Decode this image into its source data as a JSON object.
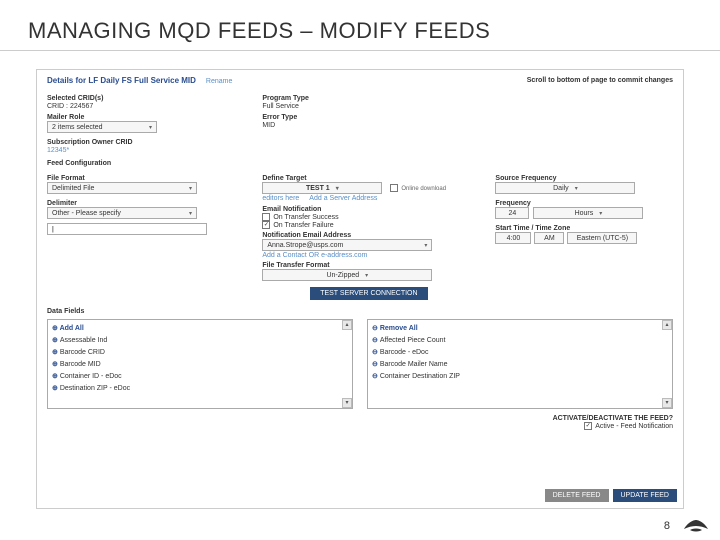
{
  "slide": {
    "title": "MANAGING MQD FEEDS – MODIFY FEEDS",
    "page": "8"
  },
  "header": {
    "title": "Details for LF Daily FS Full Service MID",
    "rename": "Rename",
    "note": "Scroll to bottom of page to commit changes"
  },
  "crid": {
    "sel_label": "Selected CRID(s)",
    "crid_line": "CRID : 224567",
    "role_label": "Mailer Role",
    "dd": "2 items selected",
    "sub_label": "Subscription Owner CRID",
    "sub_val": "12345*"
  },
  "prog": {
    "type_label": "Program Type",
    "type_val": "Full Service",
    "err_label": "Error Type",
    "err_val": "MID"
  },
  "feed": {
    "section": "Feed Configuration",
    "format_label": "File Format",
    "format_dd": "Delimited File",
    "delim_label": "Delimiter",
    "delim_dd": "Other - Please specify",
    "delim_txt": "|"
  },
  "target": {
    "label": "Define Target",
    "dd": "TEST 1",
    "online_chk": "Online download",
    "edit_link": "editors here",
    "addnew": "Add a Server Address",
    "notif_label": "Email Notification",
    "on_success": "On Transfer Success",
    "on_failure": "On Transfer Failure",
    "notif_addr_label": "Notification Email Address",
    "notif_addr_val": "Anna.Strope@usps.com",
    "add_contact": "Add a Contact OR e-address.com",
    "ftf_label": "File Transfer Format",
    "ftf_dd": "Un-Zipped",
    "test_btn": "TEST SERVER CONNECTION"
  },
  "source": {
    "freq_label": "Source Frequency",
    "freq_dd": "Daily",
    "freq2_label": "Frequency",
    "freq2_num": "24",
    "freq2_unit": "Hours",
    "time_label": "Start Time / Time Zone",
    "time_h": "4:00",
    "time_ampm": "AM",
    "time_tz": "Eastern (UTC-5)"
  },
  "lists": {
    "section": "Data Fields",
    "add_all": "Add All",
    "remove_all": "Remove All",
    "avail": [
      "Assessable Ind",
      "Barcode CRID",
      "Barcode MID",
      "Container ID - eDoc",
      "Destination ZIP - eDoc"
    ],
    "sel": [
      "Affected Piece Count",
      "Barcode - eDoc",
      "Barcode Mailer Name",
      "Container Destination ZIP"
    ]
  },
  "activate": {
    "q": "ACTIVATE/DEACTIVATE THE FEED?",
    "lbl": "Active - Feed Notification"
  },
  "buttons": {
    "delete": "DELETE FEED",
    "update": "UPDATE FEED"
  }
}
